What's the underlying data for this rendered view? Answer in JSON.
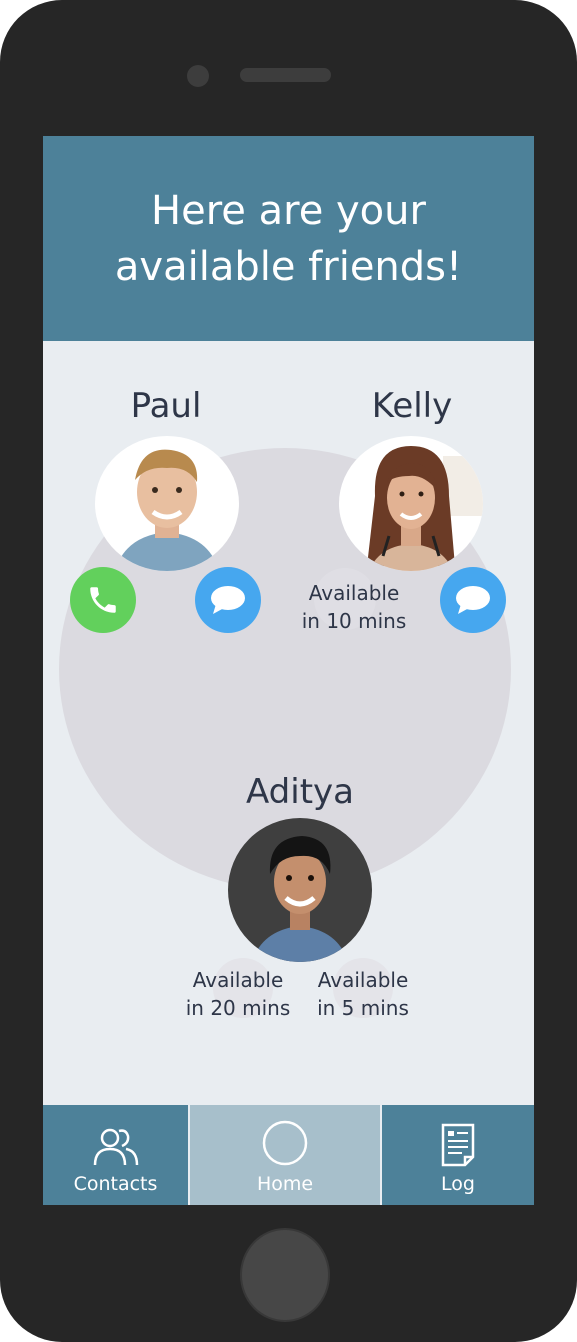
{
  "header": {
    "title": "Here are your\navailable friends!"
  },
  "friends": [
    {
      "name": "Paul",
      "status": ""
    },
    {
      "name": "Kelly",
      "status": "Available\nin 10 mins"
    },
    {
      "name": "Aditya",
      "status": ""
    }
  ],
  "pending": [
    {
      "status": "Available\nin 20 mins"
    },
    {
      "status": "Available\nin 5 mins"
    }
  ],
  "actions": {
    "call_icon": "phone-icon",
    "message_icon": "chat-bubble-icon"
  },
  "tabs": [
    {
      "label": "Contacts",
      "icon": "contacts-icon"
    },
    {
      "label": "Home",
      "icon": "home-circle-icon",
      "selected": true
    },
    {
      "label": "Log",
      "icon": "log-document-icon"
    }
  ],
  "colors": {
    "header": "#4d8199",
    "tab_selected": "#a7bfcb",
    "call": "#62d05c",
    "message": "#46a7ef",
    "background": "#e9edf1"
  }
}
